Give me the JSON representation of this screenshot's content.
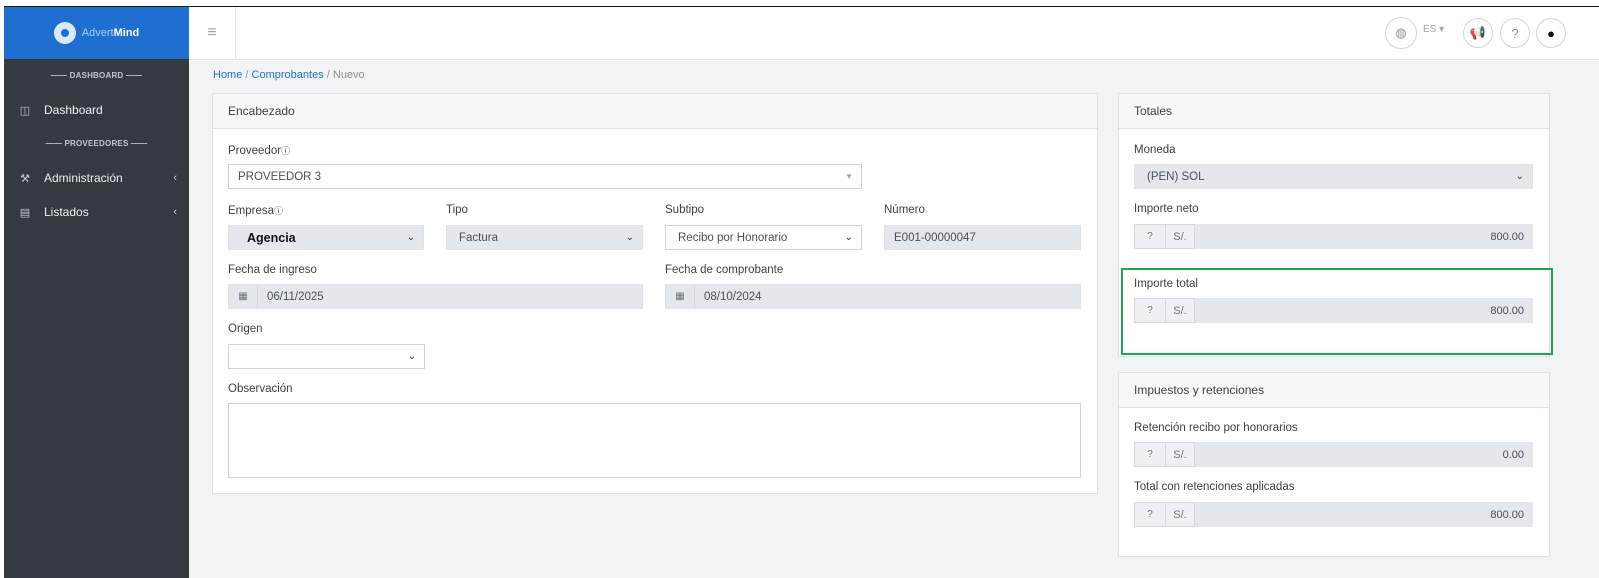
{
  "brand": {
    "name_prefix": "Advert",
    "name_suffix": "Mind"
  },
  "sidebar": {
    "section1": "DASHBOARD",
    "section2": "PROVEEDORES",
    "items": [
      {
        "label": "Dashboard",
        "icon": "columns-icon"
      },
      {
        "label": "Administración",
        "icon": "wrench-icon"
      },
      {
        "label": "Listados",
        "icon": "list-icon"
      }
    ]
  },
  "topbar": {
    "language": "ES"
  },
  "breadcrumb": {
    "home": "Home",
    "section": "Comprobantes",
    "current": "Nuevo"
  },
  "encabezado": {
    "title": "Encabezado",
    "proveedor_label": "Proveedor",
    "proveedor_value": "PROVEEDOR 3",
    "empresa_label": "Empresa",
    "empresa_value": "Agencia",
    "tipo_label": "Tipo",
    "tipo_value": "Factura",
    "subtipo_label": "Subtipo",
    "subtipo_value": "Recibo por Honorario",
    "numero_label": "Número",
    "numero_value": "E001-00000047",
    "fecha_ingreso_label": "Fecha de ingreso",
    "fecha_ingreso_value": "06/11/2025",
    "fecha_comprobante_label": "Fecha de comprobante",
    "fecha_comprobante_value": "08/10/2024",
    "origen_label": "Origen",
    "origen_value": "",
    "observacion_label": "Observación",
    "observacion_value": ""
  },
  "totales": {
    "title": "Totales",
    "moneda_label": "Moneda",
    "moneda_value": "(PEN) SOL",
    "currency_symbol": "S/.",
    "importe_neto_label": "Importe neto",
    "importe_neto_value": "800.00",
    "importe_total_label": "Importe total",
    "importe_total_value": "800.00"
  },
  "impuestos": {
    "title": "Impuestos y retenciones",
    "retencion_label": "Retención recibo por honorarios",
    "retencion_value": "0.00",
    "total_label": "Total con retenciones aplicadas",
    "total_value": "800.00"
  },
  "colors": {
    "sidebar": "#343a40",
    "brand": "#1f6fd0",
    "highlight": "#19a84a"
  }
}
